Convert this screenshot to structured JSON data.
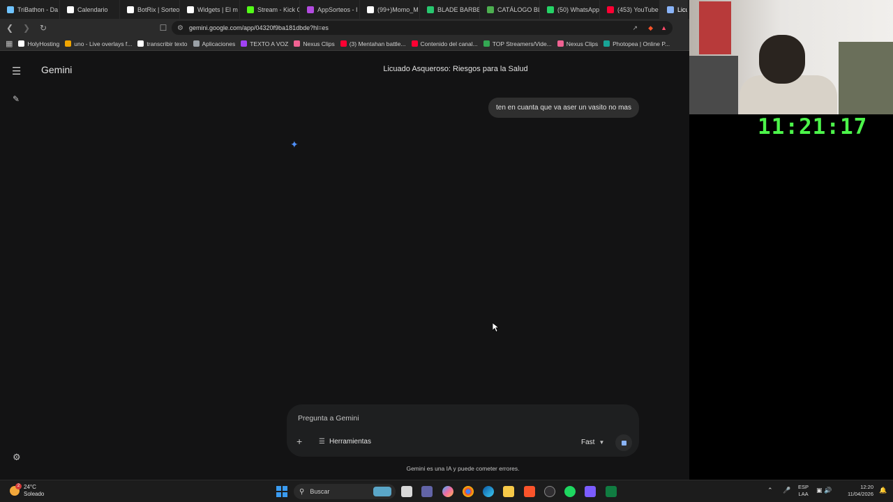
{
  "browser": {
    "tabs": [
      {
        "label": "TriBathon - Da",
        "color": "#6fc3ff"
      },
      {
        "label": "Calendario",
        "color": "#ffffff"
      },
      {
        "label": "BotRix | Sorteo",
        "color": "#ffffff"
      },
      {
        "label": "Widgets | El m",
        "color": "#ffffff"
      },
      {
        "label": "Stream - Kick C",
        "color": "#53fc18"
      },
      {
        "label": "AppSorteos - I",
        "color": "#b34be0"
      },
      {
        "label": "(99+)Momo_M",
        "color": "#ffffff"
      },
      {
        "label": "BLADE BARBE",
        "color": "#28c76f"
      },
      {
        "label": "CATÁLOGO BL",
        "color": "#4caf50"
      },
      {
        "label": "(50) WhatsApp",
        "color": "#25d366"
      },
      {
        "label": "(453) YouTube",
        "color": "#ff0033"
      },
      {
        "label": "Licu",
        "color": "#8ab4f8"
      }
    ],
    "url": "gemini.google.com/app/04320f9ba181dbde?hl=es",
    "bookmarks": [
      {
        "label": "HolyHosting",
        "color": "#ffffff"
      },
      {
        "label": "uno - Live overlays f...",
        "color": "#f0a500"
      },
      {
        "label": "transcribir texto",
        "color": "#ffffff"
      },
      {
        "label": "Aplicaciones",
        "color": "#9aa0a6"
      },
      {
        "label": "TEXTO A VOZ",
        "color": "#a142f4"
      },
      {
        "label": "Nexus Clips",
        "color": "#f06292"
      },
      {
        "label": "(3) Mentahan battle...",
        "color": "#ff0033"
      },
      {
        "label": "Contenido del canal...",
        "color": "#ff0033"
      },
      {
        "label": "TOP Streamers/Vide...",
        "color": "#34a853"
      },
      {
        "label": "Nexus Clips",
        "color": "#f06292"
      },
      {
        "label": "Photopea | Online P...",
        "color": "#18a497"
      }
    ]
  },
  "gemini": {
    "brand": "Gemini",
    "chat_title": "Licuado Asqueroso: Riesgos para la Salud",
    "user_message": "ten en cuanta que va aser un vasito no mas",
    "composer": {
      "placeholder": "Pregunta a Gemini",
      "tools_label": "Herramientas",
      "model_label": "Fast"
    },
    "disclaimer": "Gemini es una IA y puede cometer errores."
  },
  "stream": {
    "clock": "11:21:17"
  },
  "taskbar": {
    "weather_temp": "24°C",
    "weather_desc": "Soleado",
    "weather_badge": "2",
    "search_label": "Buscar",
    "lang_line1": "ESP",
    "lang_line2": "LAA",
    "time": "12:20",
    "date": "11/04/2026"
  }
}
